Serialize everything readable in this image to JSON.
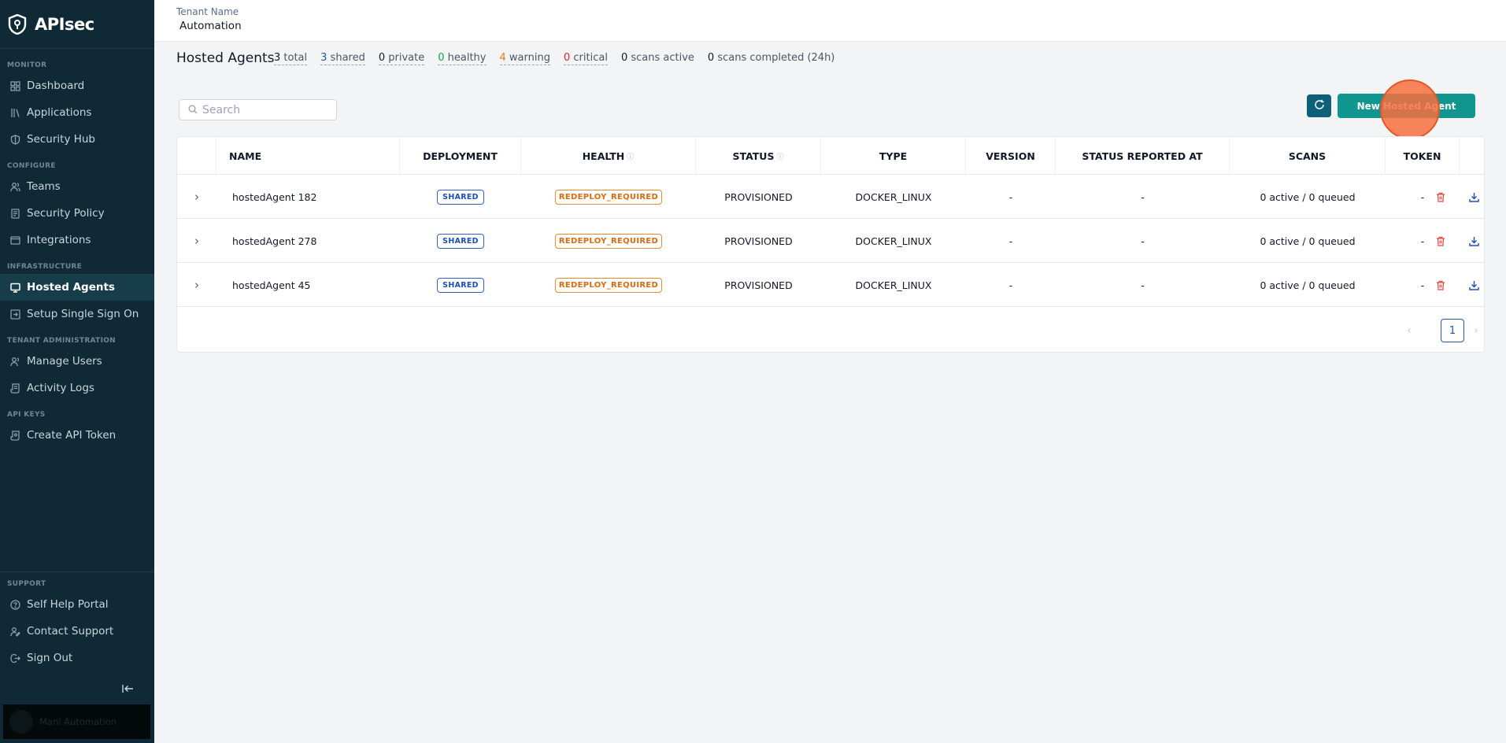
{
  "brand": {
    "name": "APIsec"
  },
  "sidebar": {
    "sections": {
      "monitor": "MONITOR",
      "configure": "CONFIGURE",
      "infrastructure": "INFRASTRUCTURE",
      "tenant_admin": "TENANT ADMINISTRATION",
      "api_keys": "API KEYS",
      "support": "SUPPORT"
    },
    "items": {
      "dashboard": "Dashboard",
      "applications": "Applications",
      "security_hub": "Security Hub",
      "teams": "Teams",
      "security_policy": "Security Policy",
      "integrations": "Integrations",
      "hosted_agents": "Hosted Agents",
      "sso": "Setup Single Sign On",
      "manage_users": "Manage Users",
      "activity_logs": "Activity Logs",
      "create_api_token": "Create API Token",
      "self_help": "Self Help Portal",
      "contact_support": "Contact Support",
      "sign_out": "Sign Out"
    },
    "active": "hosted_agents",
    "user": {
      "name": "Mani Automation"
    }
  },
  "header": {
    "tenant_label": "Tenant Name",
    "tenant_value": "Automation"
  },
  "page": {
    "title": "Hosted Agents",
    "stats": {
      "total": {
        "num": "3",
        "label": " total"
      },
      "shared": {
        "num": "3",
        "label": " shared"
      },
      "private": {
        "num": "0",
        "label": " private"
      },
      "healthy": {
        "num": "0",
        "label": " healthy"
      },
      "warning": {
        "num": "4",
        "label": " warning"
      },
      "critical": {
        "num": "0",
        "label": " critical"
      },
      "scans_active": {
        "num": "0",
        "label": " scans active"
      },
      "scans_completed": {
        "num": "0",
        "label": " scans completed (24h)"
      }
    },
    "search_placeholder": "Search",
    "new_button": "New Hosted Agent"
  },
  "table": {
    "columns": {
      "name": "NAME",
      "deployment": "DEPLOYMENT",
      "health": "HEALTH",
      "status": "STATUS",
      "type": "TYPE",
      "version": "VERSION",
      "reported_at": "STATUS REPORTED AT",
      "scans": "SCANS",
      "token": "TOKEN"
    },
    "rows": [
      {
        "name": "hostedAgent 182",
        "deployment": "SHARED",
        "health": "REDEPLOY_REQUIRED",
        "status": "PROVISIONED",
        "type": "DOCKER_LINUX",
        "version": "-",
        "reported_at": "-",
        "scans": "0 active / 0 queued",
        "token": "-"
      },
      {
        "name": "hostedAgent 278",
        "deployment": "SHARED",
        "health": "REDEPLOY_REQUIRED",
        "status": "PROVISIONED",
        "type": "DOCKER_LINUX",
        "version": "-",
        "reported_at": "-",
        "scans": "0 active / 0 queued",
        "token": "-"
      },
      {
        "name": "hostedAgent 45",
        "deployment": "SHARED",
        "health": "REDEPLOY_REQUIRED",
        "status": "PROVISIONED",
        "type": "DOCKER_LINUX",
        "version": "-",
        "reported_at": "-",
        "scans": "0 active / 0 queued",
        "token": "-"
      }
    ],
    "pagination": {
      "current_page": "1"
    }
  },
  "colors": {
    "sidebar_bg": "#0f2a36",
    "accent_teal": "#11968f",
    "refresh_btn": "#0e5f78",
    "shared_badge": "#1e4fb0",
    "redeploy_badge": "#d86a10",
    "delete_icon": "#e04848",
    "download_icon": "#1e4fb0"
  }
}
